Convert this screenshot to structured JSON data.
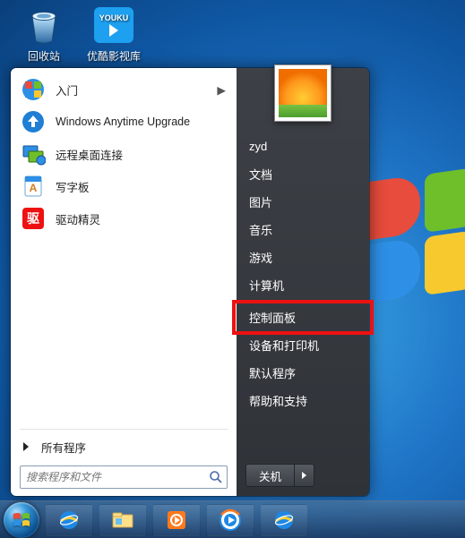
{
  "desktop": {
    "icons": [
      {
        "name": "recycle-bin",
        "label": "回收站"
      },
      {
        "name": "youku-library",
        "label": "优酷影视库",
        "badge": "YOUKU"
      }
    ]
  },
  "start_menu": {
    "programs": [
      {
        "id": "getting-started",
        "label": "入门",
        "has_submenu": true
      },
      {
        "id": "anytime-upgrade",
        "label": "Windows Anytime Upgrade",
        "has_submenu": false
      },
      {
        "id": "remote-desktop",
        "label": "远程桌面连接",
        "has_submenu": false
      },
      {
        "id": "wordpad",
        "label": "写字板",
        "has_submenu": false
      },
      {
        "id": "driver-genius",
        "label": "驱动精灵",
        "has_submenu": false
      }
    ],
    "all_programs_label": "所有程序",
    "search_placeholder": "搜索程序和文件",
    "right": {
      "user": "zyd",
      "items_top": [
        "文档",
        "图片",
        "音乐",
        "游戏",
        "计算机"
      ],
      "items_bottom": [
        "控制面板",
        "设备和打印机",
        "默认程序",
        "帮助和支持"
      ],
      "highlighted_index": 0,
      "shutdown_label": "关机"
    }
  },
  "taskbar": {
    "pinned": [
      "internet-explorer",
      "file-explorer",
      "windows-media-center",
      "windows-media-player",
      "internet-explorer-alt"
    ]
  }
}
